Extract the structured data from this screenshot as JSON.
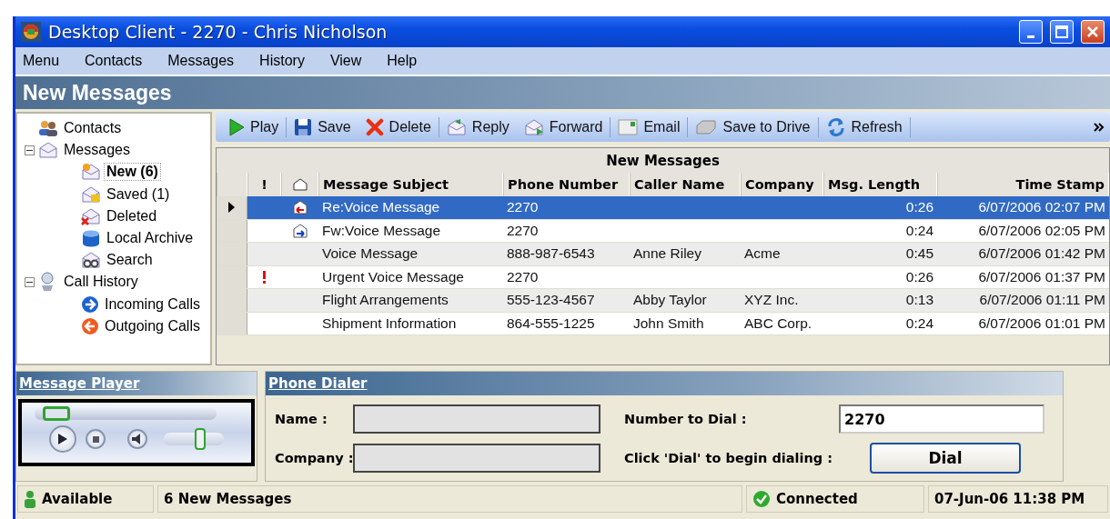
{
  "window": {
    "title": "Desktop Client - 2270 - Chris Nicholson"
  },
  "menu": [
    "Menu",
    "Contacts",
    "Messages",
    "History",
    "View",
    "Help"
  ],
  "page_title": "New Messages",
  "tree": [
    {
      "label": "Contacts",
      "bold": false,
      "selected": false
    },
    {
      "label": "Messages",
      "expanded": true,
      "bold": false,
      "selected": false,
      "children": [
        {
          "label": "New (6)",
          "bold": true,
          "selected": true
        },
        {
          "label": "Saved (1)",
          "bold": false,
          "selected": false
        },
        {
          "label": "Deleted",
          "bold": false,
          "selected": false
        },
        {
          "label": "Local Archive",
          "bold": false,
          "selected": false
        },
        {
          "label": "Search",
          "bold": false,
          "selected": false
        }
      ]
    },
    {
      "label": "Call History",
      "expanded": true,
      "bold": false,
      "selected": false,
      "children": [
        {
          "label": "Incoming Calls",
          "bold": false,
          "selected": false
        },
        {
          "label": "Outgoing Calls",
          "bold": false,
          "selected": false
        }
      ]
    }
  ],
  "toolbar": [
    "Play",
    "Save",
    "Delete",
    "Reply",
    "Forward",
    "Email",
    "Save to Drive",
    "Refresh"
  ],
  "grid": {
    "caption": "New Messages",
    "columns": [
      "!",
      "Message Subject",
      "Phone Number",
      "Caller Name",
      "Company",
      "Msg. Length",
      "Time Stamp"
    ],
    "rows": [
      {
        "selected": true,
        "urgent": false,
        "replied": true,
        "forwarded": false,
        "subject": "Re:Voice Message",
        "phone": "2270",
        "caller": "",
        "company": "",
        "length": "0:26",
        "time": "6/07/2006 02:07 PM"
      },
      {
        "selected": false,
        "urgent": false,
        "replied": false,
        "forwarded": true,
        "subject": "Fw:Voice Message",
        "phone": "2270",
        "caller": "",
        "company": "",
        "length": "0:24",
        "time": "6/07/2006 02:05 PM"
      },
      {
        "selected": false,
        "urgent": false,
        "replied": false,
        "forwarded": false,
        "subject": "Voice Message",
        "phone": "888-987-6543",
        "caller": "Anne Riley",
        "company": "Acme",
        "length": "0:45",
        "time": "6/07/2006 01:42 PM"
      },
      {
        "selected": false,
        "urgent": true,
        "replied": false,
        "forwarded": false,
        "subject": "Urgent Voice Message",
        "phone": "2270",
        "caller": "",
        "company": "",
        "length": "0:26",
        "time": "6/07/2006 01:37 PM"
      },
      {
        "selected": false,
        "urgent": false,
        "replied": false,
        "forwarded": false,
        "subject": "Flight Arrangements",
        "phone": "555-123-4567",
        "caller": "Abby Taylor",
        "company": "XYZ Inc.",
        "length": "0:13",
        "time": "6/07/2006 01:11 PM"
      },
      {
        "selected": false,
        "urgent": false,
        "replied": false,
        "forwarded": false,
        "subject": "Shipment Information",
        "phone": "864-555-1225",
        "caller": "John Smith",
        "company": "ABC Corp.",
        "length": "0:24",
        "time": "6/07/2006 01:01 PM"
      }
    ]
  },
  "player": {
    "title": "Message Player",
    "progress": {
      "level": 0.05
    },
    "volume": {
      "level": 0.6
    }
  },
  "dialer": {
    "title": "Phone Dialer",
    "name_label": "Name :",
    "company_label": "Company :",
    "number_label": "Number to Dial :",
    "number_value": "2270",
    "hint": "Click 'Dial' to begin dialing :",
    "button": "Dial"
  },
  "status_bar": {
    "presence": "Available",
    "messages": "6 New Messages",
    "connection": "Connected",
    "datetime": "07-Jun-06 11:38 PM"
  }
}
